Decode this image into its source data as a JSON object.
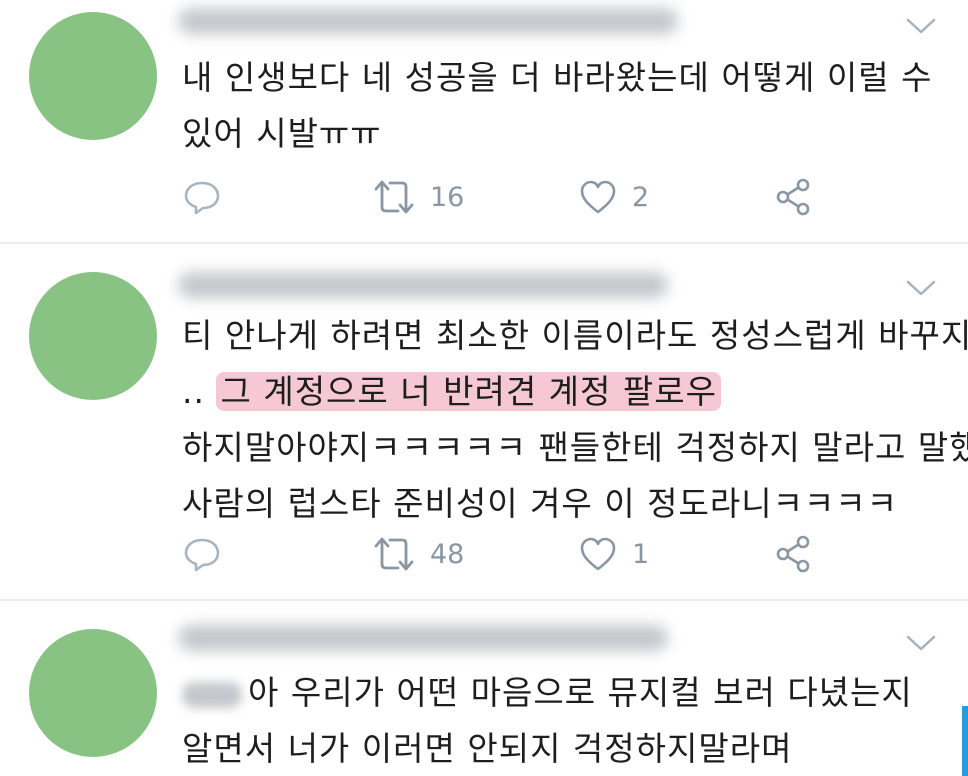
{
  "colors": {
    "avatar": "#88c384",
    "highlight": "#f6c8d5",
    "icon": "#8a96a3",
    "text": "#1e1e1e"
  },
  "tweets": [
    {
      "lines": [
        "내 인생보다 네 성공을 더 바라왔는데 어떻게 이럴 수",
        "있어 시발ㅠㅠ"
      ],
      "retweets": "16",
      "likes": "2",
      "icons": [
        "reply-icon",
        "retweet-icon",
        "like-icon",
        "share-icon",
        "chevron-down-icon"
      ]
    },
    {
      "line1": "티 안나게 하려면 최소한 이름이라도 정성스럽게 바꾸지",
      "line2_prefix": "..",
      "line2_highlight": "그 계정으로 너 반려견 계정 팔로우",
      "line3": "하지말아야지ㅋㅋㅋㅋㅋ 팬들한테 걱정하지 말라고 말했던",
      "line4": "사람의 럽스타 준비성이 겨우 이 정도라니ㅋㅋㅋㅋ",
      "retweets": "48",
      "likes": "1",
      "icons": [
        "reply-icon",
        "retweet-icon",
        "like-icon",
        "share-icon",
        "chevron-down-icon"
      ]
    },
    {
      "line1_rest": "아 우리가 어떤 마음으로 뮤지컬 보러 다녔는지",
      "line2": "알면서 너가 이러면 안되지 걱정하지말라며",
      "icons": [
        "chevron-down-icon"
      ]
    }
  ]
}
